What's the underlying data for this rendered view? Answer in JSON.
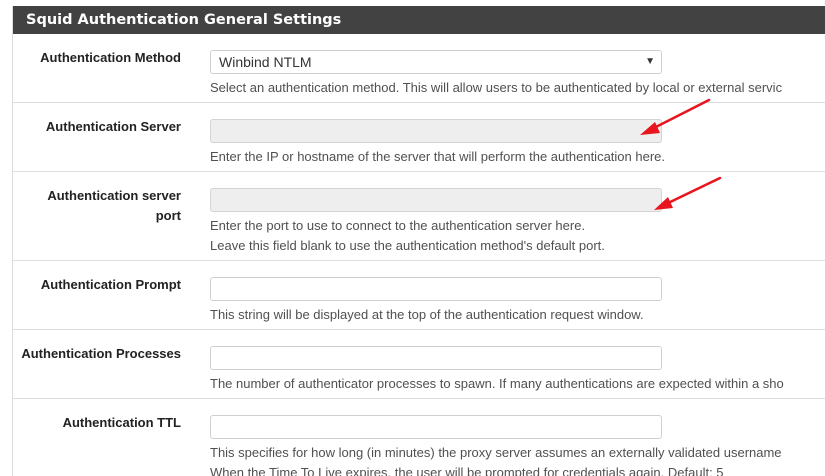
{
  "panel": {
    "title": "Squid Authentication General Settings"
  },
  "rows": [
    {
      "label": "Authentication Method",
      "value": "Winbind NTLM",
      "help": [
        "Select an authentication method. This will allow users to be authenticated by local or external servic"
      ]
    },
    {
      "label": "Authentication Server",
      "value": "",
      "help": [
        "Enter the IP or hostname of the server that will perform the authentication here."
      ]
    },
    {
      "label_lines": [
        "Authentication server",
        "port"
      ],
      "value": "",
      "help": [
        "Enter the port to use to connect to the authentication server here.",
        "Leave this field blank to use the authentication method's default port."
      ]
    },
    {
      "label": "Authentication Prompt",
      "value": "",
      "help": [
        "This string will be displayed at the top of the authentication request window."
      ]
    },
    {
      "label": "Authentication Processes",
      "value": "",
      "help": [
        "The number of authenticator processes to spawn. If many authentications are expected within a sho"
      ]
    },
    {
      "label": "Authentication TTL",
      "value": "",
      "help": [
        "This specifies for how long (in minutes) the proxy server assumes an externally validated username",
        "When the Time To Live expires, the user will be prompted for credentials again. Default: 5"
      ]
    }
  ],
  "colors": {
    "heading_bg": "#424242",
    "annotation_arrow": "#e8141e",
    "disabled_field": "#eeeeee"
  }
}
